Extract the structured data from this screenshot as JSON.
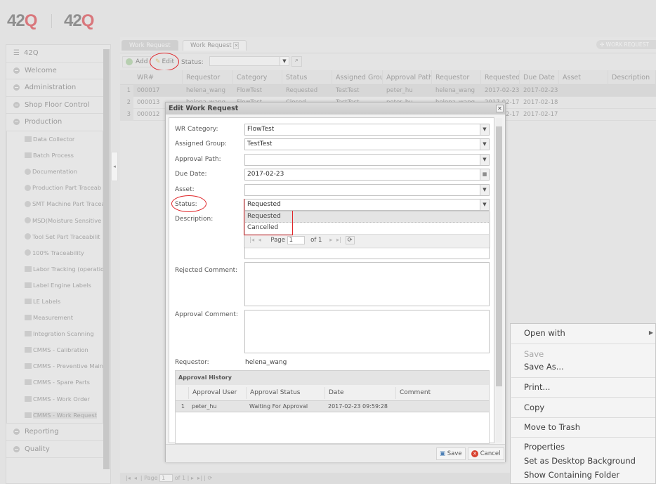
{
  "logo": {
    "text1": "42",
    "text2": "Q"
  },
  "sidebar": {
    "top": [
      {
        "label": "42Q",
        "icon": "list-icon"
      },
      {
        "label": "Welcome"
      },
      {
        "label": "Administration"
      },
      {
        "label": "Shop Floor Control"
      },
      {
        "label": "Production"
      }
    ],
    "production_items": [
      {
        "label": "Data Collector",
        "icon": "folder"
      },
      {
        "label": "Batch Process",
        "icon": "folder"
      },
      {
        "label": "Documentation",
        "icon": "plus"
      },
      {
        "label": "Production Part Traceab",
        "icon": "plus"
      },
      {
        "label": "SMT Machine Part Tracea",
        "icon": "plus"
      },
      {
        "label": "MSD(Moisture Sensitive D",
        "icon": "plus"
      },
      {
        "label": "Tool Set Part Traceabilit",
        "icon": "plus"
      },
      {
        "label": "100% Traceability",
        "icon": "plus"
      },
      {
        "label": "Labor Tracking (operatio",
        "icon": "folder"
      },
      {
        "label": "Label Engine Labels",
        "icon": "folder"
      },
      {
        "label": "LE Labels",
        "icon": "folder"
      },
      {
        "label": "Measurement",
        "icon": "folder"
      },
      {
        "label": "Integration Scanning",
        "icon": "folder"
      },
      {
        "label": "CMMS - Calibration",
        "icon": "folder"
      },
      {
        "label": "CMMS - Preventive Maint",
        "icon": "folder"
      },
      {
        "label": "CMMS - Spare Parts",
        "icon": "folder"
      },
      {
        "label": "CMMS - Work Order",
        "icon": "folder"
      },
      {
        "label": "CMMS - Work Request",
        "icon": "folder"
      }
    ],
    "bottom": [
      {
        "label": "Reporting"
      },
      {
        "label": "Quality"
      }
    ]
  },
  "tabs": [
    {
      "label": "Work Request"
    },
    {
      "label": "Work Request"
    }
  ],
  "header_button": "WORK REQUEST",
  "toolbar": {
    "add": "Add",
    "edit": "Edit",
    "status_label": "Status:",
    "status_value": ""
  },
  "grid": {
    "columns": [
      "WR#",
      "Requestor",
      "Category",
      "Status",
      "Assigned Grou",
      "Approval Path",
      "Requestor",
      "Requested",
      "Due Date",
      "Asset",
      "Description"
    ],
    "rows": [
      [
        "1",
        "000017",
        "helena_wang",
        "FlowTest",
        "Requested",
        "TestTest",
        "peter_hu",
        "helena_wang",
        "2017-02-23",
        "2017-02-23",
        "",
        ""
      ],
      [
        "2",
        "000013",
        "helena_wang",
        "FlowTest",
        "Closed",
        "TestTest",
        "peter_hu",
        "helena_wang",
        "2017-02-17",
        "2017-02-18",
        "",
        ""
      ],
      [
        "3",
        "000012",
        "",
        "",
        "",
        "",
        "",
        "",
        "2017-02-17",
        "2017-02-17",
        "",
        ""
      ]
    ]
  },
  "pager": {
    "page_label": "Page",
    "page": "1",
    "of": "of 1"
  },
  "dialog": {
    "title": "Edit Work Request",
    "fields": [
      {
        "label": "WR Category:",
        "value": "FlowTest",
        "type": "select"
      },
      {
        "label": "Assigned Group:",
        "value": "TestTest",
        "type": "select"
      },
      {
        "label": "Approval Path:",
        "value": "",
        "type": "select"
      },
      {
        "label": "Due Date:",
        "value": "2017-02-23",
        "type": "date"
      },
      {
        "label": "Asset:",
        "value": "",
        "type": "select"
      },
      {
        "label": "Status:",
        "value": "Requested",
        "type": "select"
      }
    ],
    "status_options": [
      "Requested",
      "Cancelled"
    ],
    "description_label": "Description:",
    "rejected_label": "Rejected Comment:",
    "approval_label": "Approval Comment:",
    "requestor_label": "Requestor:",
    "requestor_value": "helena_wang",
    "history": {
      "title": "Approval History",
      "columns": [
        "Approval User",
        "Approval Status",
        "Date",
        "Comment"
      ],
      "rows": [
        [
          "1",
          "peter_hu",
          "Waiting For Approval",
          "2017-02-23 09:59:28",
          ""
        ]
      ]
    },
    "save": "Save",
    "cancel": "Cancel"
  },
  "context_menu": {
    "items": [
      {
        "label": "Open with",
        "submenu": true
      },
      {
        "label": "Save",
        "disabled": true
      },
      {
        "label": "Save As..."
      },
      {
        "label": "Print..."
      },
      {
        "label": "Copy"
      },
      {
        "label": "Move to Trash"
      },
      {
        "label": "Properties"
      },
      {
        "label": "Set as Desktop Background"
      },
      {
        "label": "Show Containing Folder"
      }
    ]
  },
  "colors": {
    "annotation": "#e0262a",
    "logo_q": "#d9777c"
  }
}
